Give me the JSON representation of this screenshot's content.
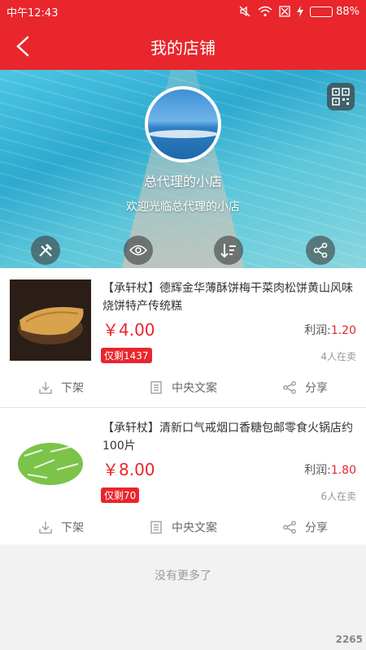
{
  "status_bar": {
    "time": "中午12:43",
    "battery": "88%",
    "battery_level": 0.88
  },
  "header": {
    "title": "我的店铺"
  },
  "shop": {
    "name": "总代理的小店",
    "welcome": "欢迎光临总代理的小店"
  },
  "hero_buttons": [
    "tools-icon",
    "eye-icon",
    "sort-icon",
    "share-icon"
  ],
  "products": [
    {
      "title": "【承轩杖】德辉金华薄酥饼梅干菜肉松饼黄山风味烧饼特产传统糕",
      "price": "￥4.00",
      "profit_label": "利润:",
      "profit_value": "1.20",
      "stock": "仅剩1437",
      "sellers": "4人在卖"
    },
    {
      "title": "【承轩杖】清新口气戒烟口香糖包邮零食火锅店约100片",
      "price": "￥8.00",
      "profit_label": "利润:",
      "profit_value": "1.80",
      "stock": "仅剩70",
      "sellers": "6人在卖"
    }
  ],
  "actions": {
    "delist": "下架",
    "copy": "中央文案",
    "share": "分享"
  },
  "footer": {
    "no_more": "没有更多了",
    "watermark": "2265"
  },
  "colors": {
    "accent": "#e8262c"
  }
}
